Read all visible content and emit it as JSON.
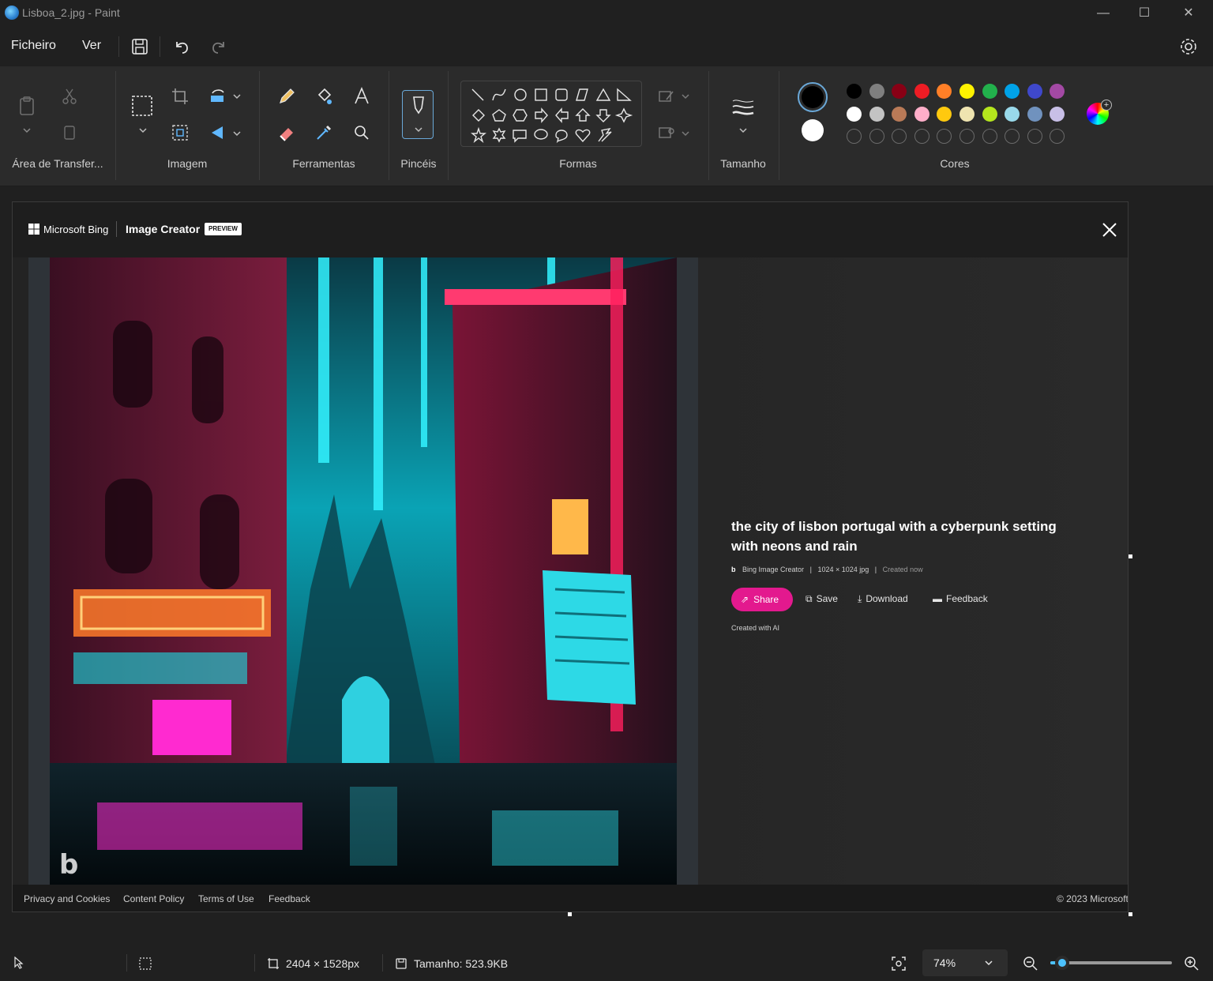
{
  "window": {
    "title": "Lisboa_2.jpg - Paint"
  },
  "menu": {
    "file": "Ficheiro",
    "view": "Ver"
  },
  "ribbon": {
    "groups": {
      "clipboard": "Área de Transfer...",
      "image": "Imagem",
      "tools": "Ferramentas",
      "brushes": "Pincéis",
      "shapes": "Formas",
      "size": "Tamanho",
      "colors": "Cores"
    },
    "colors": {
      "primary": "#000000",
      "secondary": "#ffffff",
      "row1": [
        "#000000",
        "#7f7f7f",
        "#880015",
        "#ed1c24",
        "#ff7f27",
        "#fff200",
        "#22b14c",
        "#00a2e8",
        "#3f48cc",
        "#a349a4"
      ],
      "row2": [
        "#ffffff",
        "#c3c3c3",
        "#b97a57",
        "#ffaec9",
        "#ffc90e",
        "#efe4b0",
        "#b5e61d",
        "#99d9ea",
        "#7092be",
        "#c8bfe7"
      ]
    }
  },
  "embedded_image": {
    "brand": "Microsoft Bing",
    "product": "Image Creator",
    "badge": "PREVIEW",
    "prompt_line1": "the city of lisbon portugal with a cyberpunk setting",
    "prompt_line2": "with neons and rain",
    "meta_source": "Bing Image Creator",
    "meta_dimensions": "1024 × 1024 jpg",
    "meta_created": "Created now",
    "actions": {
      "share": "Share",
      "save": "Save",
      "download": "Download",
      "feedback": "Feedback"
    },
    "created_with": "Created with AI",
    "footer": {
      "privacy": "Privacy and Cookies",
      "content_policy": "Content Policy",
      "terms": "Terms of Use",
      "feedback": "Feedback",
      "copyright": "© 2023 Microsoft"
    },
    "accent": "#e3198e"
  },
  "status": {
    "dimensions": "2404 × 1528px",
    "size": "Tamanho: 523.9KB",
    "zoom": "74%",
    "zoom_slider_fraction": 0.1
  }
}
